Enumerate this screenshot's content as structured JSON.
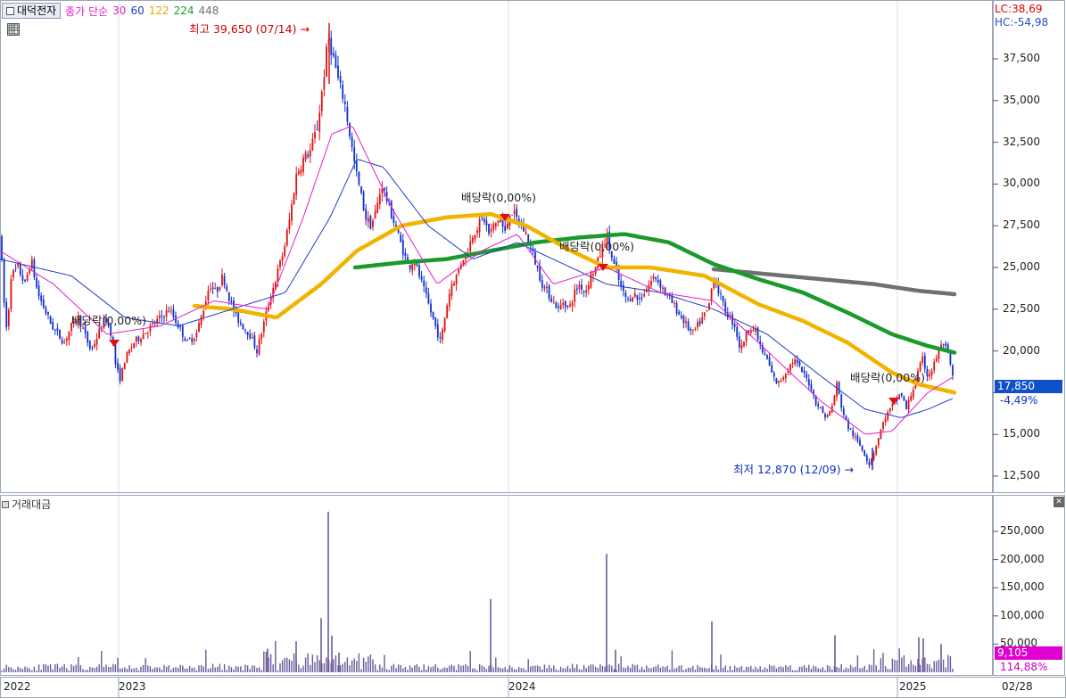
{
  "legend": {
    "stock_name": "대덕전자",
    "ma_prefix": "종가 단순",
    "ma_periods": [
      {
        "label": "30",
        "color": "#e61ec8"
      },
      {
        "label": "60",
        "color": "#1e3cc8"
      },
      {
        "label": "122",
        "color": "#f0a800"
      },
      {
        "label": "224",
        "color": "#1a9a2a"
      },
      {
        "label": "448",
        "color": "#707070"
      }
    ]
  },
  "top_right": {
    "lc": "LC:38,69",
    "hc": "HC:-54,98"
  },
  "annotations": {
    "high": "최고 39,650 (07/14)",
    "low": "최저 12,870 (12/09)",
    "ex_dividend": [
      "배당락(0,00%)",
      "배당락(0,00%)",
      "배당락(0,00%)",
      "배당락(0,00%)"
    ]
  },
  "price_axis": {
    "ticks": [
      "37,500",
      "35,000",
      "32,500",
      "30,000",
      "27,500",
      "25,000",
      "22,500",
      "20,000",
      "17,500",
      "15,000",
      "12,500"
    ],
    "current_price": "17,850",
    "current_change": "-4,49%"
  },
  "volume": {
    "title": "거래대금",
    "ticks": [
      "250,000",
      "200,000",
      "150,000",
      "100,000",
      "50,000"
    ],
    "current_value": "9,105",
    "current_ratio": "114,88%"
  },
  "time_axis": {
    "labels": [
      "2022",
      "2023",
      "2024",
      "2025"
    ],
    "end_label": "02/28"
  },
  "colors": {
    "up": "#e01010",
    "down": "#1030d0",
    "ma30": "#e61ec8",
    "ma60": "#1e3cc8",
    "ma122": "#f0b400",
    "ma224": "#1a9a2a",
    "ma448": "#707070",
    "volume": "#6a5a9a",
    "price_tag_bg": "#1050c8",
    "volume_tag_bg": "#e000d0"
  },
  "chart_data": {
    "type": "candlestick",
    "x_range": [
      "2022-01",
      "2025-02-28"
    ],
    "price_range": [
      12000,
      39900
    ],
    "price_high": {
      "value": 39650,
      "date": "07/14"
    },
    "price_low": {
      "value": 12870,
      "date": "12/09"
    },
    "price_series": [
      [
        0,
        27000
      ],
      [
        5,
        22500
      ],
      [
        8,
        21000
      ],
      [
        12,
        24500
      ],
      [
        20,
        25000
      ],
      [
        28,
        24000
      ],
      [
        35,
        25500
      ],
      [
        42,
        23500
      ],
      [
        50,
        22500
      ],
      [
        58,
        21500
      ],
      [
        65,
        21000
      ],
      [
        72,
        20500
      ],
      [
        80,
        21500
      ],
      [
        88,
        22000
      ],
      [
        95,
        21000
      ],
      [
        102,
        20000
      ],
      [
        110,
        21000
      ],
      [
        118,
        22000
      ],
      [
        125,
        21000
      ],
      [
        130,
        19000
      ],
      [
        135,
        18300
      ],
      [
        140,
        19500
      ],
      [
        150,
        20500
      ],
      [
        160,
        21000
      ],
      [
        170,
        21500
      ],
      [
        180,
        22000
      ],
      [
        190,
        22500
      ],
      [
        200,
        21500
      ],
      [
        210,
        20500
      ],
      [
        220,
        21000
      ],
      [
        228,
        22500
      ],
      [
        235,
        24000
      ],
      [
        242,
        23500
      ],
      [
        250,
        24500
      ],
      [
        258,
        23000
      ],
      [
        265,
        22000
      ],
      [
        272,
        21500
      ],
      [
        280,
        21000
      ],
      [
        288,
        20000
      ],
      [
        295,
        21500
      ],
      [
        302,
        23000
      ],
      [
        310,
        24500
      ],
      [
        318,
        26000
      ],
      [
        325,
        28000
      ],
      [
        332,
        30500
      ],
      [
        340,
        31500
      ],
      [
        348,
        32000
      ],
      [
        356,
        33500
      ],
      [
        362,
        36000
      ],
      [
        368,
        38800
      ],
      [
        374,
        37500
      ],
      [
        380,
        36000
      ],
      [
        386,
        35000
      ],
      [
        392,
        33000
      ],
      [
        398,
        31000
      ],
      [
        404,
        29500
      ],
      [
        410,
        28000
      ],
      [
        416,
        27500
      ],
      [
        422,
        28500
      ],
      [
        428,
        30000
      ],
      [
        434,
        29000
      ],
      [
        440,
        28000
      ],
      [
        446,
        27000
      ],
      [
        452,
        26000
      ],
      [
        458,
        25000
      ],
      [
        464,
        25500
      ],
      [
        470,
        24500
      ],
      [
        476,
        23500
      ],
      [
        482,
        22500
      ],
      [
        488,
        21500
      ],
      [
        494,
        20500
      ],
      [
        500,
        22500
      ],
      [
        506,
        24000
      ],
      [
        512,
        24500
      ],
      [
        518,
        25500
      ],
      [
        524,
        26000
      ],
      [
        530,
        27000
      ],
      [
        536,
        27500
      ],
      [
        542,
        28000
      ],
      [
        548,
        27000
      ],
      [
        554,
        27500
      ],
      [
        560,
        28000
      ],
      [
        566,
        27000
      ],
      [
        572,
        28500
      ],
      [
        578,
        28000
      ],
      [
        584,
        27500
      ],
      [
        590,
        27000
      ],
      [
        596,
        26000
      ],
      [
        602,
        25000
      ],
      [
        608,
        24000
      ],
      [
        614,
        23500
      ],
      [
        620,
        23000
      ],
      [
        626,
        22500
      ],
      [
        632,
        23000
      ],
      [
        638,
        22500
      ],
      [
        644,
        23500
      ],
      [
        650,
        24000
      ],
      [
        656,
        23500
      ],
      [
        662,
        24500
      ],
      [
        668,
        25000
      ],
      [
        674,
        26000
      ],
      [
        680,
        27000
      ],
      [
        686,
        25500
      ],
      [
        692,
        24500
      ],
      [
        698,
        23500
      ],
      [
        704,
        23000
      ],
      [
        710,
        23500
      ],
      [
        716,
        23000
      ],
      [
        722,
        23500
      ],
      [
        728,
        24000
      ],
      [
        734,
        24500
      ],
      [
        740,
        24000
      ],
      [
        746,
        23500
      ],
      [
        752,
        23000
      ],
      [
        758,
        22500
      ],
      [
        764,
        22000
      ],
      [
        770,
        21500
      ],
      [
        776,
        21000
      ],
      [
        782,
        21500
      ],
      [
        788,
        22000
      ],
      [
        794,
        22500
      ],
      [
        800,
        24500
      ],
      [
        806,
        23500
      ],
      [
        812,
        22500
      ],
      [
        818,
        22000
      ],
      [
        824,
        21500
      ],
      [
        830,
        20000
      ],
      [
        836,
        21000
      ],
      [
        842,
        21500
      ],
      [
        848,
        21000
      ],
      [
        854,
        20000
      ],
      [
        860,
        19500
      ],
      [
        866,
        18500
      ],
      [
        872,
        18000
      ],
      [
        878,
        18500
      ],
      [
        884,
        19000
      ],
      [
        890,
        19500
      ],
      [
        896,
        19000
      ],
      [
        902,
        18500
      ],
      [
        908,
        18000
      ],
      [
        914,
        17000
      ],
      [
        920,
        16500
      ],
      [
        926,
        16000
      ],
      [
        932,
        16500
      ],
      [
        938,
        18000
      ],
      [
        944,
        16500
      ],
      [
        950,
        15500
      ],
      [
        956,
        15000
      ],
      [
        962,
        14500
      ],
      [
        968,
        14000
      ],
      [
        974,
        13200
      ],
      [
        980,
        14000
      ],
      [
        986,
        15000
      ],
      [
        992,
        16000
      ],
      [
        998,
        16500
      ],
      [
        1004,
        17000
      ],
      [
        1010,
        17500
      ],
      [
        1016,
        16500
      ],
      [
        1022,
        17500
      ],
      [
        1028,
        18500
      ],
      [
        1034,
        19500
      ],
      [
        1040,
        18500
      ],
      [
        1046,
        19000
      ],
      [
        1052,
        20000
      ],
      [
        1058,
        20500
      ],
      [
        1064,
        19500
      ],
      [
        1070,
        17850
      ]
    ],
    "ma30": [
      [
        0,
        26000
      ],
      [
        60,
        24000
      ],
      [
        120,
        21000
      ],
      [
        180,
        21500
      ],
      [
        240,
        23000
      ],
      [
        300,
        22500
      ],
      [
        340,
        28000
      ],
      [
        372,
        33000
      ],
      [
        395,
        33500
      ],
      [
        440,
        28500
      ],
      [
        490,
        24000
      ],
      [
        540,
        26000
      ],
      [
        580,
        27000
      ],
      [
        620,
        24000
      ],
      [
        680,
        25000
      ],
      [
        740,
        23500
      ],
      [
        800,
        23000
      ],
      [
        860,
        20000
      ],
      [
        920,
        17000
      ],
      [
        970,
        15000
      ],
      [
        1000,
        15200
      ],
      [
        1040,
        17500
      ],
      [
        1070,
        18500
      ]
    ],
    "ma60": [
      [
        0,
        25500
      ],
      [
        80,
        24500
      ],
      [
        140,
        22000
      ],
      [
        200,
        21500
      ],
      [
        260,
        22500
      ],
      [
        320,
        23500
      ],
      [
        370,
        28000
      ],
      [
        400,
        31500
      ],
      [
        430,
        31000
      ],
      [
        480,
        27500
      ],
      [
        530,
        25500
      ],
      [
        580,
        26500
      ],
      [
        620,
        25500
      ],
      [
        680,
        24000
      ],
      [
        740,
        23500
      ],
      [
        800,
        22500
      ],
      [
        860,
        21000
      ],
      [
        920,
        18500
      ],
      [
        970,
        16500
      ],
      [
        1010,
        16000
      ],
      [
        1040,
        16500
      ],
      [
        1070,
        17200
      ]
    ],
    "ma122": [
      [
        218,
        22700
      ],
      [
        260,
        22500
      ],
      [
        310,
        22000
      ],
      [
        360,
        24000
      ],
      [
        400,
        26000
      ],
      [
        450,
        27500
      ],
      [
        500,
        28000
      ],
      [
        550,
        28200
      ],
      [
        590,
        27500
      ],
      [
        640,
        26000
      ],
      [
        680,
        25000
      ],
      [
        730,
        25000
      ],
      [
        790,
        24500
      ],
      [
        850,
        22800
      ],
      [
        900,
        21800
      ],
      [
        950,
        20500
      ],
      [
        1000,
        18700
      ],
      [
        1030,
        18000
      ],
      [
        1070,
        17500
      ]
    ],
    "ma224": [
      [
        398,
        25000
      ],
      [
        450,
        25300
      ],
      [
        500,
        25500
      ],
      [
        550,
        26000
      ],
      [
        600,
        26500
      ],
      [
        650,
        26800
      ],
      [
        700,
        27000
      ],
      [
        750,
        26500
      ],
      [
        800,
        25200
      ],
      [
        850,
        24300
      ],
      [
        900,
        23500
      ],
      [
        950,
        22300
      ],
      [
        1000,
        21000
      ],
      [
        1040,
        20300
      ],
      [
        1070,
        19900
      ]
    ],
    "ma448": [
      [
        800,
        24900
      ],
      [
        860,
        24600
      ],
      [
        920,
        24300
      ],
      [
        980,
        24000
      ],
      [
        1030,
        23600
      ],
      [
        1070,
        23400
      ]
    ],
    "volume_range": [
      0,
      290000
    ],
    "volume_spikes": [
      [
        300,
        42000
      ],
      [
        332,
        55000
      ],
      [
        360,
        96000
      ],
      [
        368,
        285000
      ],
      [
        372,
        65000
      ],
      [
        380,
        35000
      ],
      [
        550,
        130000
      ],
      [
        680,
        210000
      ],
      [
        690,
        40000
      ],
      [
        798,
        90000
      ],
      [
        936,
        66000
      ],
      [
        1030,
        62000
      ],
      [
        1035,
        60000
      ],
      [
        1055,
        50000
      ]
    ]
  }
}
